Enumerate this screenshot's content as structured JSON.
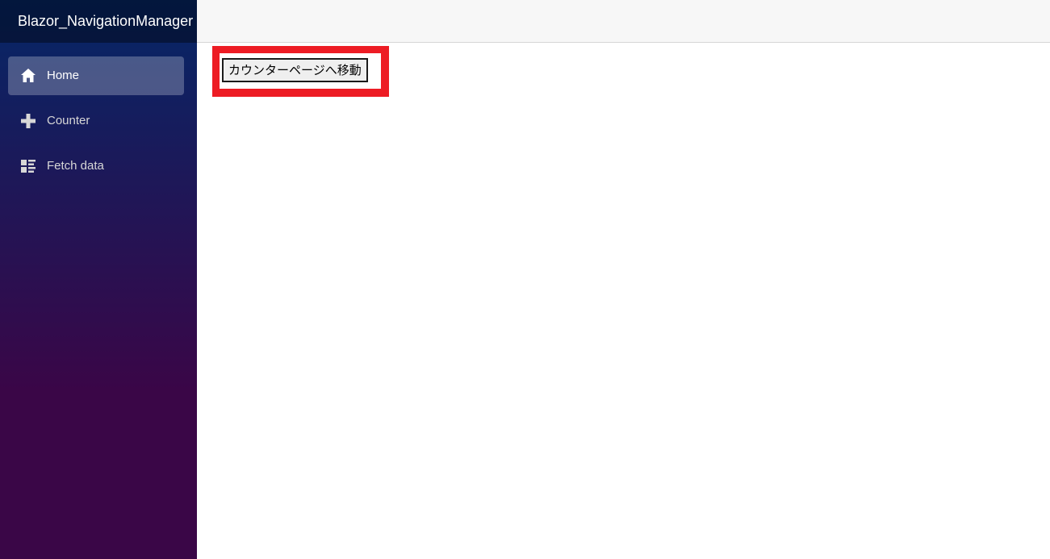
{
  "app": {
    "brand": "Blazor_NavigationManager"
  },
  "sidebar": {
    "items": [
      {
        "label": "Home",
        "icon": "home-icon",
        "active": true
      },
      {
        "label": "Counter",
        "icon": "plus-icon",
        "active": false
      },
      {
        "label": "Fetch data",
        "icon": "list-rich-icon",
        "active": false
      }
    ]
  },
  "main": {
    "navigate_button_label": "カウンターページへ移動"
  },
  "colors": {
    "sidebar_gradient_top": "#052767",
    "sidebar_gradient_bottom": "#3a0647",
    "highlight_frame": "#ed1c24",
    "top_row_background": "#f7f7f7"
  }
}
